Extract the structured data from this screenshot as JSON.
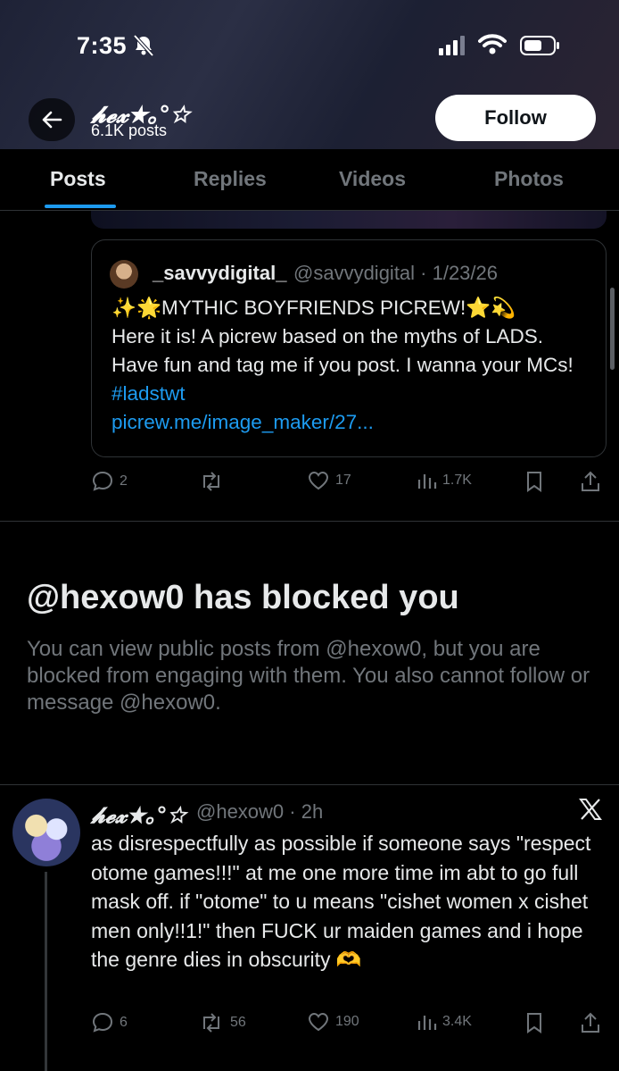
{
  "status_bar": {
    "time": "7:35"
  },
  "profile": {
    "name": "𝓱𝓮𝔁★｡°☆",
    "posts_count": "6.1K posts",
    "follow_label": "Follow"
  },
  "tabs": [
    {
      "label": "Posts",
      "active": true
    },
    {
      "label": "Replies",
      "active": false
    },
    {
      "label": "Videos",
      "active": false
    },
    {
      "label": "Photos",
      "active": false
    }
  ],
  "quoted_post": {
    "name": "_savvydigital_",
    "handle_date": "@savvydigital · 1/23/26",
    "line1": "✨🌟MYTHIC BOYFRIENDS PICREW!⭐💫",
    "text": "Here it is! A picrew based on the myths of LADS. Have fun and tag me if you post. I wanna your MCs! ",
    "hashtag": "#ladstwt",
    "link": "picrew.me/image_maker/27..."
  },
  "first_post_stats": {
    "replies": "2",
    "reposts": "",
    "likes": "17",
    "views": "1.7K"
  },
  "blocked": {
    "title": "@hexow0 has blocked you",
    "description": "You can view public posts from @hexow0, but you are blocked from engaging with them. You also cannot follow or message @hexow0."
  },
  "post": {
    "name": "𝓱𝓮𝔁★｡°☆",
    "handle_time": "@hexow0 · 2h",
    "text": "as disrespectfully as possible if someone says \"respect otome games!!!\" at me one more time im abt to go full mask off. if \"otome\" to u means \"cishet women x cishet men only!!1!\" then FUCK ur maiden games and i hope the genre dies in obscurity 🫶",
    "stats": {
      "replies": "6",
      "reposts": "56",
      "likes": "190",
      "views": "3.4K"
    }
  },
  "colors": {
    "accent": "#1d9bf0",
    "muted": "#71767b",
    "text": "#e7e9ea",
    "border": "#2f3336"
  }
}
